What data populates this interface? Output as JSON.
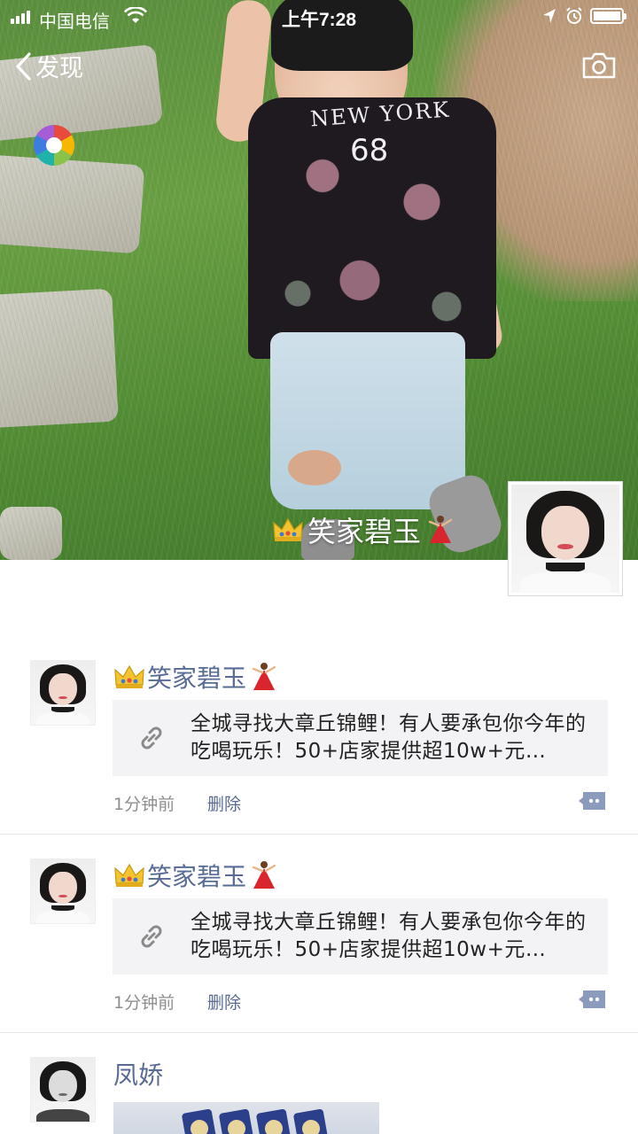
{
  "status_bar": {
    "carrier": "中国电信",
    "time": "上午7:28",
    "battery_level": 1.0
  },
  "nav": {
    "back_label": "发现",
    "back_icon": "chevron-left-icon",
    "camera_icon": "camera-icon"
  },
  "cover": {
    "user_name": "笑家碧玉",
    "shirt_text": "NEW YORK",
    "shirt_number": "68"
  },
  "posts": [
    {
      "author": "笑家碧玉",
      "link_text": "全城寻找大章丘锦鲤！有人要承包你今年的吃喝玩乐！50+店家提供超10w+元…",
      "time": "1分钟前",
      "delete_label": "删除"
    },
    {
      "author": "笑家碧玉",
      "link_text": "全城寻找大章丘锦鲤！有人要承包你今年的吃喝玩乐！50+店家提供超10w+元…",
      "time": "1分钟前",
      "delete_label": "删除"
    },
    {
      "author": "凤娇"
    }
  ],
  "colors": {
    "link_blue": "#576b95",
    "card_bg": "#f3f3f5",
    "muted_text": "#8e8e8e"
  }
}
